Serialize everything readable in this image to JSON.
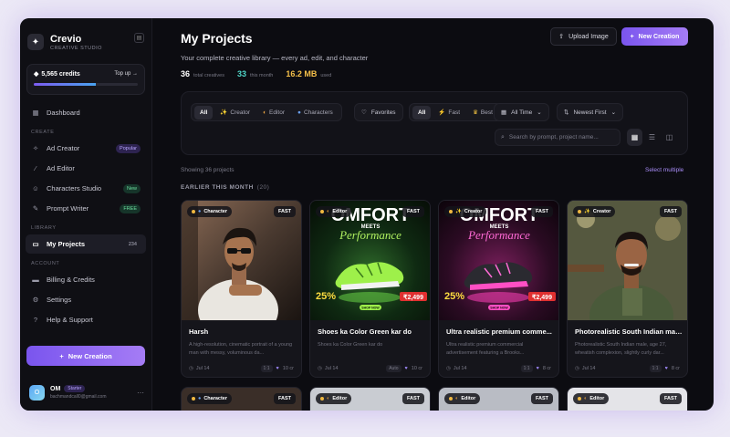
{
  "brand": {
    "name": "Crevio",
    "subtitle": "CREATIVE STUDIO",
    "logo_icon": "spark-icon"
  },
  "credits": {
    "label": "5,565 credits",
    "topup": "Top up →",
    "fill_fraction": 0.6
  },
  "sidebar": {
    "top_items": [
      {
        "label": "Dashboard",
        "icon": "grid-icon"
      }
    ],
    "create_section": "CREATE",
    "create_items": [
      {
        "label": "Ad Creator",
        "badge": "Popular",
        "icon": "sparkle-icon"
      },
      {
        "label": "Ad Editor",
        "badge": "",
        "icon": "wand-icon"
      },
      {
        "label": "Characters Studio",
        "badge": "New",
        "icon": "users-icon"
      },
      {
        "label": "Prompt Writer",
        "badge": "FREE",
        "icon": "pen-icon"
      }
    ],
    "library_section": "LIBRARY",
    "library_items": [
      {
        "label": "My Projects",
        "badge": "234",
        "icon": "folder-icon"
      }
    ],
    "account_section": "ACCOUNT",
    "account_items": [
      {
        "label": "Billing & Credits",
        "icon": "card-icon"
      },
      {
        "label": "Settings",
        "icon": "gear-icon"
      },
      {
        "label": "Help & Support",
        "icon": "help-icon"
      }
    ],
    "new_creation": "New Creation"
  },
  "user": {
    "initials": "O",
    "name": "OM",
    "plan": "Starter",
    "email": "bachmandcall0@gmail.com"
  },
  "header": {
    "title": "My Projects",
    "subtitle": "Your complete creative library — every ad, edit, and character",
    "upload": "Upload Image",
    "new_creation": "New Creation"
  },
  "stats": [
    {
      "value": "36",
      "label": "total creatives",
      "color": "#ffffff"
    },
    {
      "value": "33",
      "label": "this month",
      "color": "#4fd6c8"
    },
    {
      "value": "16.2 MB",
      "label": "used",
      "color": "#f5c04a"
    }
  ],
  "filters": {
    "type_chips": [
      "All",
      "Creator",
      "Editor",
      "Characters"
    ],
    "favorites": "Favorites",
    "quality_chips": [
      "All",
      "Fast",
      "Best"
    ],
    "time": "All Time",
    "sort": "Newest First",
    "search_placeholder": "Search by prompt, project name..."
  },
  "showing": "Showing 36 projects",
  "select_multiple": "Select multiple",
  "group": {
    "label": "EARLIER THIS MONTH",
    "count": "(20)"
  },
  "cards": [
    {
      "type": "Character",
      "speed": "FAST",
      "title": "Harsh",
      "desc": "A high-resolution, cinematic portrait of a young man with messy, voluminous da...",
      "date": "Jul 14",
      "format": "1:1",
      "cost": "10 cr"
    },
    {
      "type": "Editor",
      "speed": "FAST",
      "title": "Shoes ka Color Green kar do",
      "desc": "Shoes ka Color Green kar do",
      "date": "Jul 14",
      "format": "Auto",
      "cost": "10 cr"
    },
    {
      "type": "Creator",
      "speed": "FAST",
      "title": "Ultra realistic premium comme...",
      "desc": "Ultra realistic premium commercial advertisement featuring a Brooks...",
      "date": "Jul 14",
      "format": "1:1",
      "cost": "8 cr"
    },
    {
      "type": "Creator",
      "speed": "FAST",
      "title": "Photorealistic South Indian mal...",
      "desc": "Photorealistic South Indian male, age 27, wheatish complexion, slightly curly dar...",
      "date": "Jul 14",
      "format": "1:1",
      "cost": "8 cr"
    }
  ],
  "lower_cards": [
    {
      "type": "Character",
      "speed": "FAST"
    },
    {
      "type": "Editor",
      "speed": "FAST"
    },
    {
      "type": "Editor",
      "speed": "FAST"
    },
    {
      "type": "Editor",
      "speed": "FAST"
    }
  ],
  "shoe_text": {
    "line1": "OMFORT",
    "line2": "MEETS",
    "line3": "Performance",
    "discount": "25%",
    "price": "₹2,499",
    "cta": "SHOP NOW"
  }
}
